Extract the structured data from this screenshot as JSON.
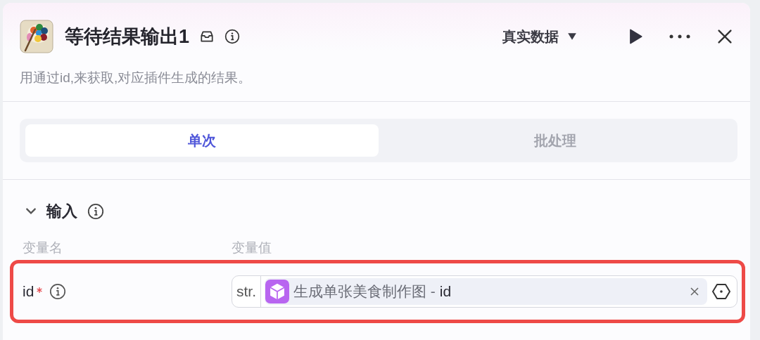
{
  "node": {
    "title": "等待结果输出1",
    "description": "用通过id,来获取,对应插件生成的结果。"
  },
  "toolbar": {
    "mode": "真实数据"
  },
  "tabs": [
    {
      "label": "单次",
      "selected": true
    },
    {
      "label": "批处理",
      "selected": false
    }
  ],
  "input_section": {
    "title": "输入",
    "expanded": true,
    "columns": [
      "变量名",
      "变量值"
    ],
    "rows": [
      {
        "name": "id",
        "required": true,
        "type": "str.",
        "source": "生成单张美食制作图 -",
        "field": "id",
        "highlighted": true
      }
    ]
  }
}
